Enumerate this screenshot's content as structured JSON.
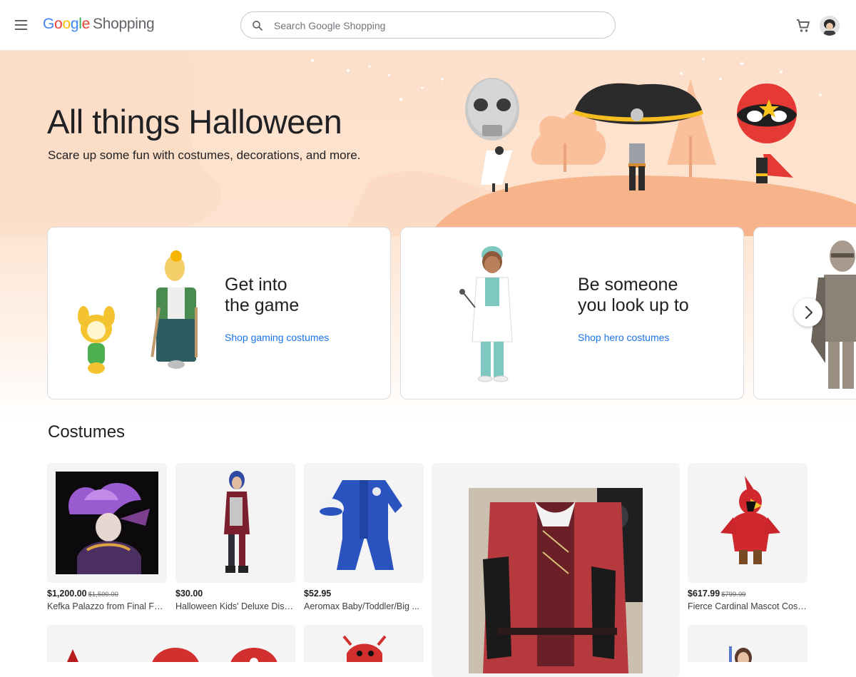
{
  "header": {
    "logo": {
      "google": [
        "G",
        "o",
        "o",
        "g",
        "l",
        "e"
      ],
      "shopping": "Shopping"
    },
    "search_placeholder": "Search Google Shopping"
  },
  "hero": {
    "title": "All things Halloween",
    "subtitle": "Scare up some fun with costumes, decorations, and more."
  },
  "categories": [
    {
      "title_line1": "Get into",
      "title_line2": "the game",
      "link": "Shop gaming costumes"
    },
    {
      "title_line1": "Be someone",
      "title_line2": "you look up to",
      "link": "Shop hero costumes"
    }
  ],
  "costumes": {
    "title": "Costumes",
    "products": [
      {
        "price": "$1,200.00",
        "old_price": "$1,500.00",
        "name": "Kefka Palazzo from Final Fan..."
      },
      {
        "price": "$30.00",
        "old_price": "",
        "name": "Halloween Kids' Deluxe Disn..."
      },
      {
        "price": "$52.95",
        "old_price": "",
        "name": "Aeromax Baby/Toddler/Big ..."
      },
      {
        "price": "$617.99",
        "old_price": "$799.99",
        "name": "Fierce Cardinal Mascot Cost..."
      }
    ]
  },
  "colors": {
    "accent_link": "#1a73e8",
    "hero_bg": "#fde0cb"
  }
}
